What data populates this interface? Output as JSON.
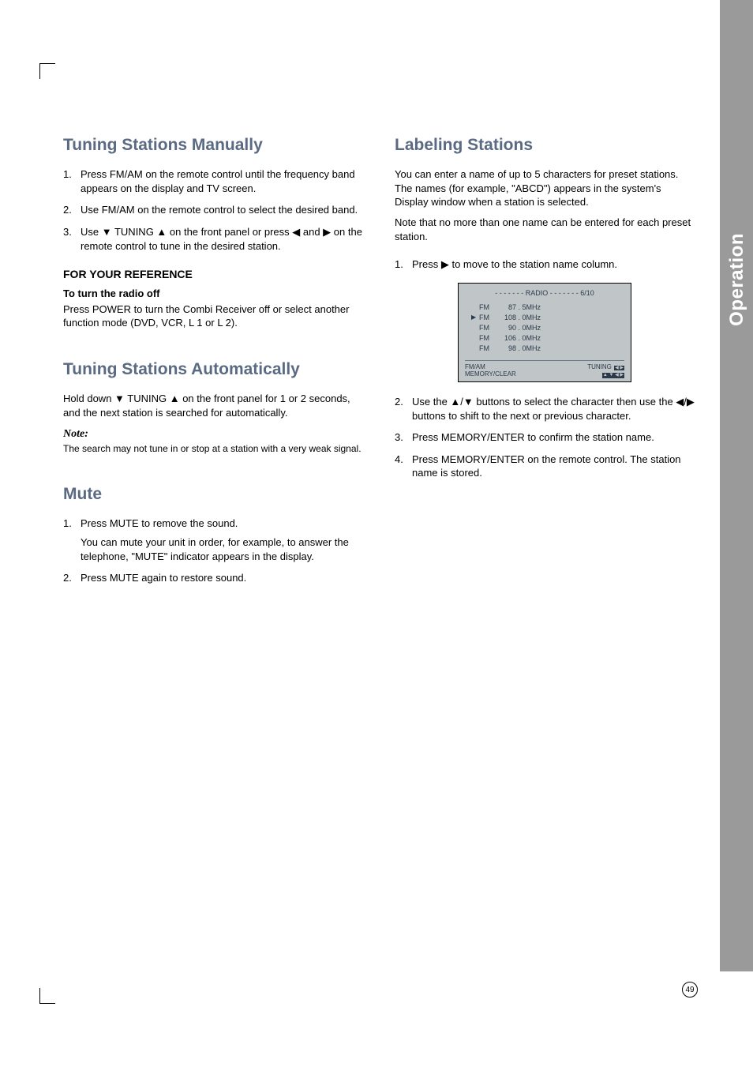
{
  "sideLabel": "Operation",
  "pageNumber": "49",
  "left": {
    "h_manual": "Tuning Stations Manually",
    "manual_steps": [
      "Press FM/AM on the remote control until the frequency band appears on the display and TV screen.",
      "Use FM/AM on the remote control to select the desired band.",
      "Use ▼ TUNING ▲  on the front panel or press ◀  and  ▶  on the remote control to tune in the desired station."
    ],
    "ref_heading": "FOR YOUR REFERENCE",
    "ref_sub": "To turn the radio off",
    "ref_body": "Press POWER to turn the Combi Receiver off or select another function mode (DVD, VCR, L 1 or L 2).",
    "h_auto": "Tuning Stations Automatically",
    "auto_body": "Hold down ▼ TUNING ▲  on the front panel for 1 or 2 seconds, and the next station is searched for automatically.",
    "note_label": "Note:",
    "note_body": "The search may not tune in or stop at a station with a very weak signal.",
    "h_mute": "Mute",
    "mute_steps": [
      {
        "a": "Press MUTE to remove the sound.",
        "b": "You can mute your unit in order, for example, to answer the telephone, \"MUTE\" indicator appears in the display."
      },
      {
        "a": "Press MUTE again to restore sound."
      }
    ]
  },
  "right": {
    "h_label": "Labeling Stations",
    "intro1": "You can enter a name of up to 5 characters for preset stations. The names (for example, \"ABCD\") appears in the system's Display window when a station is selected.",
    "intro2": "Note that no more than one name can be entered for each preset station.",
    "step1": "Press ▶ to move to the station name column.",
    "osd": {
      "title": "- - - - - - - RADIO - - - - - - - 6/10",
      "rows": [
        {
          "sel": false,
          "band": "FM",
          "freq": "87 . 5MHz"
        },
        {
          "sel": true,
          "band": "FM",
          "freq": "108 . 0MHz"
        },
        {
          "sel": false,
          "band": "FM",
          "freq": "90 . 0MHz"
        },
        {
          "sel": false,
          "band": "FM",
          "freq": "106 . 0MHz"
        },
        {
          "sel": false,
          "band": "FM",
          "freq": "98 . 0MHz"
        }
      ],
      "footer_l1": "FM/AM",
      "footer_l2": "MEMORY/CLEAR",
      "footer_r1": "TUNING",
      "footer_r1_icons": "◀ ▶",
      "footer_r2_icons": "▲ ▼ ◀ ▶"
    },
    "label_steps_rest": [
      "Use the ▲/▼ buttons to select the character then use the ◀/▶ buttons to shift to the next or previous character.",
      "Press MEMORY/ENTER to confirm the station name.",
      "Press MEMORY/ENTER on the remote control. The station name is stored."
    ]
  }
}
